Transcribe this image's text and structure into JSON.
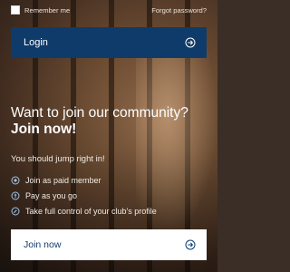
{
  "topbar": {
    "remember_label": "Remember me",
    "forgot_label": "Forgot password?"
  },
  "login": {
    "label": "Login"
  },
  "join": {
    "headline_line1": "Want to join our community?",
    "headline_line2": "Join now!",
    "intro": "You should jump right in!",
    "benefits": [
      {
        "label": "Join as paid member",
        "icon": "medal-icon"
      },
      {
        "label": "Pay as you go",
        "icon": "coin-icon"
      },
      {
        "label": "Take full control of your club's profile",
        "icon": "wrench-icon"
      }
    ],
    "button_label": "Join now"
  },
  "colors": {
    "primary": "#0f3b6b",
    "white": "#ffffff",
    "icon_accent": "#9ec3e6"
  }
}
